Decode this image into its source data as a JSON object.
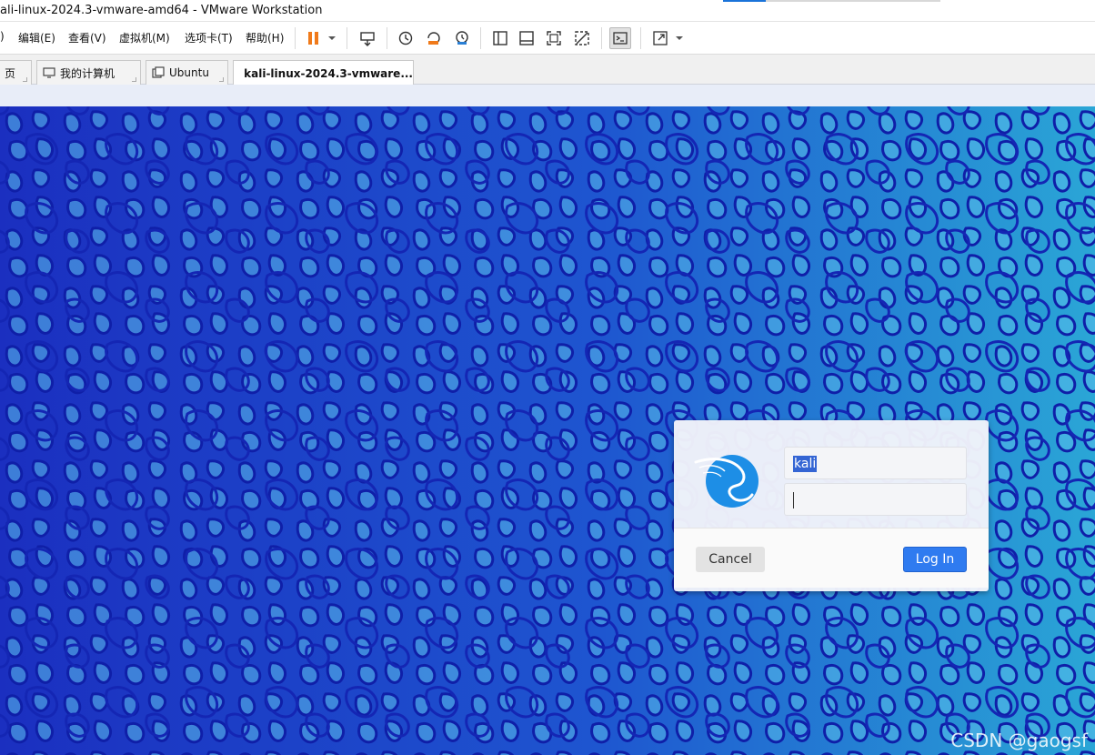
{
  "window": {
    "title": "ali-linux-2024.3-vmware-amd64 - VMware Workstation"
  },
  "menu": {
    "items": [
      {
        "label": ")"
      },
      {
        "label": "编辑(E)"
      },
      {
        "label": "查看(V)"
      },
      {
        "label": "虚拟机(M)"
      },
      {
        "label": "选项卡(T)"
      },
      {
        "label": "帮助(H)"
      }
    ]
  },
  "toolbar": {
    "icons": [
      "pause-icon",
      "dropdown-icon",
      "send-ctrl-alt-del-icon",
      "snapshot-icon",
      "revert-snapshot-icon",
      "snapshot-manager-icon",
      "library-icon",
      "thumbnail-icon",
      "fullscreen-icon",
      "unity-icon",
      "console-icon",
      "stretch-icon",
      "dropdown-icon"
    ]
  },
  "tabs": [
    {
      "label": "页",
      "icon": "home-icon"
    },
    {
      "label": "我的计算机",
      "icon": "computer-icon"
    },
    {
      "label": "Ubuntu",
      "icon": "vm-icon"
    },
    {
      "label": "kali-linux-2024.3-vmware...",
      "icon": "vm-running-icon",
      "active": true
    }
  ],
  "login": {
    "username_value": "kali",
    "password_value": "",
    "cancel_label": "Cancel",
    "login_label": "Log In",
    "logo": "kali-dragon-icon",
    "accent_color": "#2f7bf0"
  },
  "watermark": "CSDN @gaogsf",
  "colors": {
    "desktop_dark": "#1b34c6",
    "desktop_light": "#2aa6d6"
  }
}
